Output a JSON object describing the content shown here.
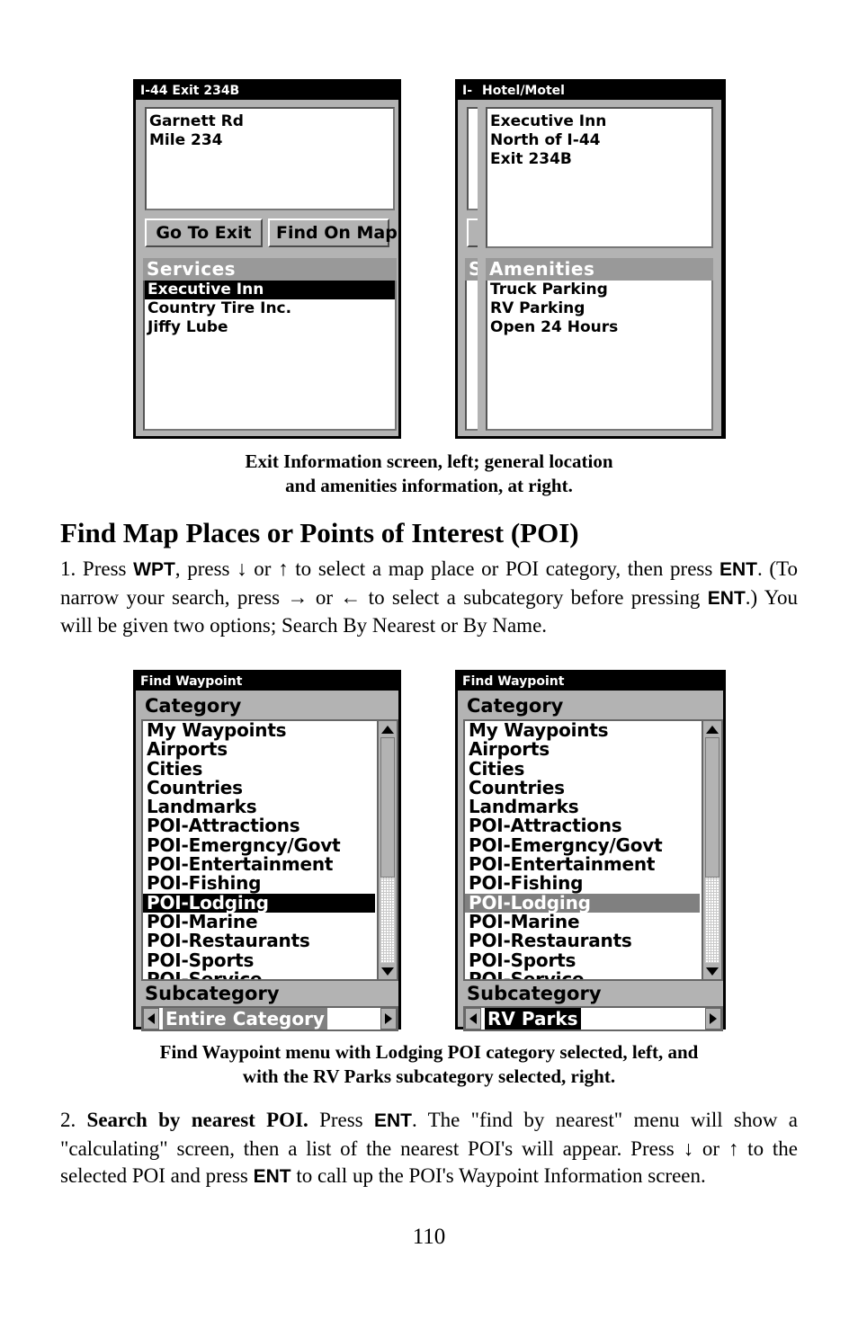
{
  "figure1": {
    "left_screen": {
      "title": "I-44 Exit 234B",
      "info_lines": [
        "Garnett Rd",
        "Mile 234"
      ],
      "buttons": [
        "Go To Exit",
        "Find On Map"
      ],
      "section_header": "Services",
      "services": [
        {
          "label": "Executive Inn",
          "selected": "black"
        },
        {
          "label": "Country Tire Inc.",
          "selected": "none"
        },
        {
          "label": "Jiffy Lube",
          "selected": "none"
        }
      ]
    },
    "right_screen": {
      "background_title_fragment": "I-",
      "background_section_fragment": "S",
      "overlay_title": "Hotel/Motel",
      "info_lines": [
        "Executive Inn",
        "North of I-44",
        "Exit 234B"
      ],
      "section_header": "Amenities",
      "amenities": [
        "Truck Parking",
        "RV Parking",
        "Open 24 Hours"
      ]
    }
  },
  "caption1": {
    "line1": "Exit Information screen, left; general location",
    "line2": "and amenities information, at right."
  },
  "heading": "Find Map Places or Points of Interest (POI)",
  "paragraph1": {
    "segment_1": "1. Press ",
    "key_1": "WPT",
    "segment_2": ", press ↓ or ↑ to select a map place or POI category, then press ",
    "key_2": "ENT",
    "segment_3": ". (To narrow your search, press → or ← to select a subcategory before pressing ",
    "key_3": "ENT",
    "segment_4": ".) You will be given two options; Search By Nearest or By Name."
  },
  "figure2": {
    "title": "Find Waypoint",
    "category_label": "Category",
    "subcategory_label": "Subcategory",
    "categories": [
      "My Waypoints",
      "Airports",
      "Cities",
      "Countries",
      "Landmarks",
      "POI-Attractions",
      "POI-Emergncy/Govt",
      "POI-Entertainment",
      "POI-Fishing",
      "POI-Lodging",
      "POI-Marine",
      "POI-Restaurants",
      "POI-Sports",
      "POI-Service"
    ],
    "left_screen": {
      "selected_category": "POI-Lodging",
      "selected_style": "black",
      "subcategory_value": "Entire Category",
      "subcategory_style": "gray"
    },
    "right_screen": {
      "selected_category": "POI-Lodging",
      "selected_style": "gray",
      "subcategory_value": "RV Parks",
      "subcategory_style": "black"
    }
  },
  "caption2": {
    "line1": "Find Waypoint menu with Lodging POI category selected, left, and",
    "line2": "with the RV Parks subcategory selected, right."
  },
  "paragraph2": {
    "segment_1": "2. ",
    "bold_1": "Search by nearest POI.",
    "segment_2": " Press ",
    "key_1": "ENT",
    "segment_3": ". The \"find by nearest\" menu will show a \"calculating\" screen, then a list of the nearest POI's will appear. Press ↓ or ↑ to the selected POI and press ",
    "key_2": "ENT",
    "segment_4": " to call up the POI's Waypoint Information screen."
  },
  "page_number": "110",
  "colors": {
    "screen_bg": "#b3b3b3",
    "titlebar": "#000000",
    "section_header": "#999999",
    "selection_black": "#000000",
    "selection_gray": "#808080"
  }
}
